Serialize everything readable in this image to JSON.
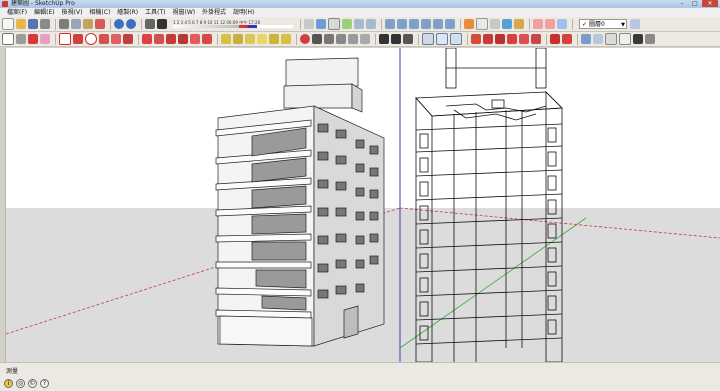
{
  "window": {
    "title": "建築圖 - SketchUp Pro",
    "minimize": "–",
    "maximize": "□",
    "close": "✕"
  },
  "menu": [
    "檔案(F)",
    "編輯(E)",
    "檢視(V)",
    "相機(C)",
    "繪製(R)",
    "工具(T)",
    "視窗(W)",
    "外掛程式",
    "說明(H)"
  ],
  "toolbar": {
    "scale_numbers": "1 2 3 4 5 6 7 8 9 10 11 12    06:09      中午      17:28",
    "layer_label": "圖層0",
    "layer_check": "✓"
  },
  "status": {
    "measure_label": "測量"
  },
  "colors": {
    "viewport_bg": "#ffffff",
    "ground": "#dcdcdc",
    "building_face": "#f4f4f4",
    "building_side": "#d9d9d9",
    "shadow": "#b0b0b0",
    "wireframe": "#111111",
    "axis_red": "#c83a3a",
    "axis_green": "#3aa83a",
    "axis_blue": "#3a3ac8"
  },
  "icons": [
    "folder-icon",
    "save-icon",
    "print-icon",
    "cut-icon",
    "copy-icon",
    "paste-icon",
    "erase-icon",
    "undo-icon",
    "redo-icon",
    "eye-icon",
    "rotate-icon",
    "sun-icon",
    "shadow-icon",
    "gear-icon",
    "home-icon",
    "front-view-icon",
    "back-view-icon",
    "left-view-icon",
    "right-view-icon",
    "style-icon",
    "component-icon",
    "layer-icon",
    "scene-icon"
  ]
}
